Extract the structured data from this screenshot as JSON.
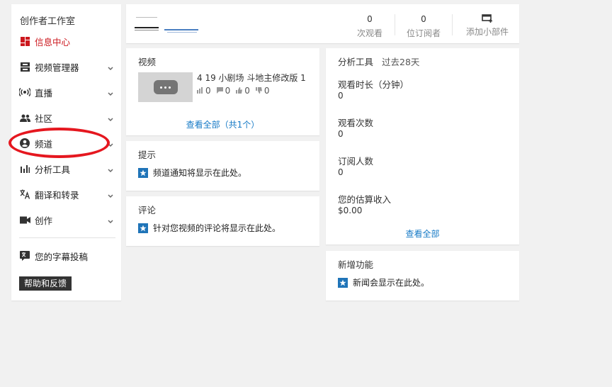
{
  "sidebar": {
    "title": "创作者工作室",
    "items": [
      {
        "label": "信息中心",
        "icon": "dashboard-icon",
        "active": true
      },
      {
        "label": "视频管理器",
        "icon": "video-manager-icon"
      },
      {
        "label": "直播",
        "icon": "live-broadcast-icon"
      },
      {
        "label": "社区",
        "icon": "community-icon"
      },
      {
        "label": "频道",
        "icon": "channel-icon"
      },
      {
        "label": "分析工具",
        "icon": "analytics-icon"
      },
      {
        "label": "翻译和转录",
        "icon": "translate-icon"
      },
      {
        "label": "创作",
        "icon": "create-icon"
      }
    ],
    "subtitle_contrib": "您的字幕投稿",
    "help_button": "帮助和反馈"
  },
  "topbar": {
    "stats": [
      {
        "value": "0",
        "label": "次观看"
      },
      {
        "value": "0",
        "label": "位订阅者"
      }
    ],
    "add_widget": "添加小部件"
  },
  "videos": {
    "title": "视频",
    "item": {
      "title": "4 19 小剧场 斗地主修改版 1",
      "likes": "0",
      "comments": "0",
      "dislikes_a": "0",
      "dislikes_b": "0"
    },
    "view_all": "查看全部（共1个）"
  },
  "tips": {
    "title": "提示",
    "message": "频道通知将显示在此处。"
  },
  "comments": {
    "title": "评论",
    "message": "针对您视频的评论将显示在此处。"
  },
  "analytics": {
    "title": "分析工具",
    "period": "过去28天",
    "metrics": [
      {
        "label": "观看时长（分钟）",
        "value": "0"
      },
      {
        "label": "观看次数",
        "value": "0"
      },
      {
        "label": "订阅人数",
        "value": "0"
      },
      {
        "label": "您的估算收入",
        "value": "$0.00"
      }
    ],
    "view_all": "查看全部"
  },
  "new_features": {
    "title": "新增功能",
    "message": "新闻会显示在此处。"
  },
  "colors": {
    "accent_red": "#cc181e",
    "link_blue": "#167ac6",
    "annotation_red": "#e5171f"
  }
}
